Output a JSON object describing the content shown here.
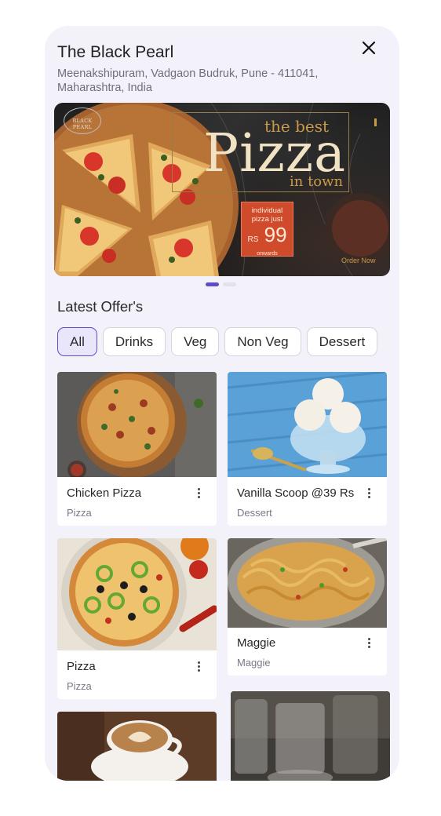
{
  "header": {
    "title": "The Black Pearl",
    "address": "Meenakshipuram, Vadgaon Budruk, Pune - 411041, Maharashtra, India"
  },
  "banner": {
    "logo_text": "BLACK PEARL",
    "tagline_top": "the best",
    "headline": "Pizza",
    "tagline_bottom": "in town",
    "offer_line1": "individual",
    "offer_line2": "pizza just",
    "offer_currency": "RS",
    "offer_price": "99",
    "offer_line3": "onwards",
    "cta": "Order Now",
    "slides_total": 2,
    "active_slide": 1
  },
  "offers": {
    "title": "Latest Offer's",
    "filters": [
      "All",
      "Drinks",
      "Veg",
      "Non Veg",
      "Dessert"
    ],
    "active_filter": "All",
    "items": [
      {
        "name": "Chicken Pizza",
        "category": "Pizza"
      },
      {
        "name": "Vanilla Scoop @39 Rs",
        "category": "Dessert"
      },
      {
        "name": "Pizza",
        "category": "Pizza"
      },
      {
        "name": "Maggie",
        "category": "Maggie"
      }
    ]
  },
  "colors": {
    "accent": "#5a4fc8",
    "sheet_bg": "#f3f2fa",
    "chip_active_bg": "#e9e6fb"
  },
  "icons": {
    "close": "close-icon",
    "more": "more-vertical-icon"
  }
}
